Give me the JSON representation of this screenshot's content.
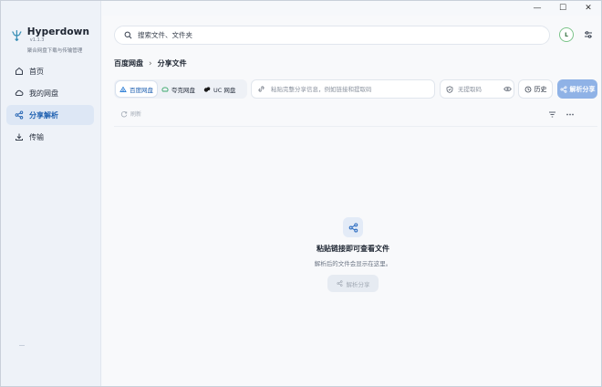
{
  "app": {
    "name": "Hyperdown",
    "version": "v1.1.3",
    "subtitle": "聚合网盘下载与传输管理"
  },
  "window_controls": {
    "minimize": "—",
    "maximize": "☐",
    "close": "✕"
  },
  "sidebar": {
    "items": [
      {
        "label": "首页",
        "icon": "home-icon"
      },
      {
        "label": "我的网盘",
        "icon": "cloud-icon"
      },
      {
        "label": "分享解析",
        "icon": "share-icon",
        "active": true
      },
      {
        "label": "传输",
        "icon": "download-icon"
      }
    ]
  },
  "header": {
    "search_placeholder": "搜索文件、文件夹",
    "avatar_letter": "L"
  },
  "breadcrumb": {
    "root": "百度网盘",
    "separator": "›",
    "current": "分享文件"
  },
  "toolbar": {
    "providers": [
      {
        "label": "百度网盘",
        "active": true
      },
      {
        "label": "夸克网盘"
      },
      {
        "label": "UC 网盘"
      }
    ],
    "link_placeholder": "粘贴完整分享信息，例如链接和提取码",
    "code_placeholder": "无提取码",
    "history_label": "历史",
    "parse_label": "解析分享"
  },
  "subbar": {
    "refresh_label": "刷新"
  },
  "empty_state": {
    "title": "粘贴链接即可查看文件",
    "subtitle": "解析后的文件会显示在这里。",
    "button_label": "解析分享"
  },
  "colors": {
    "accent": "#1d5fb0",
    "parse_button": "#8fb2e6",
    "sidebar_bg": "#eef2f8",
    "active_nav_bg": "#dde7f5"
  }
}
